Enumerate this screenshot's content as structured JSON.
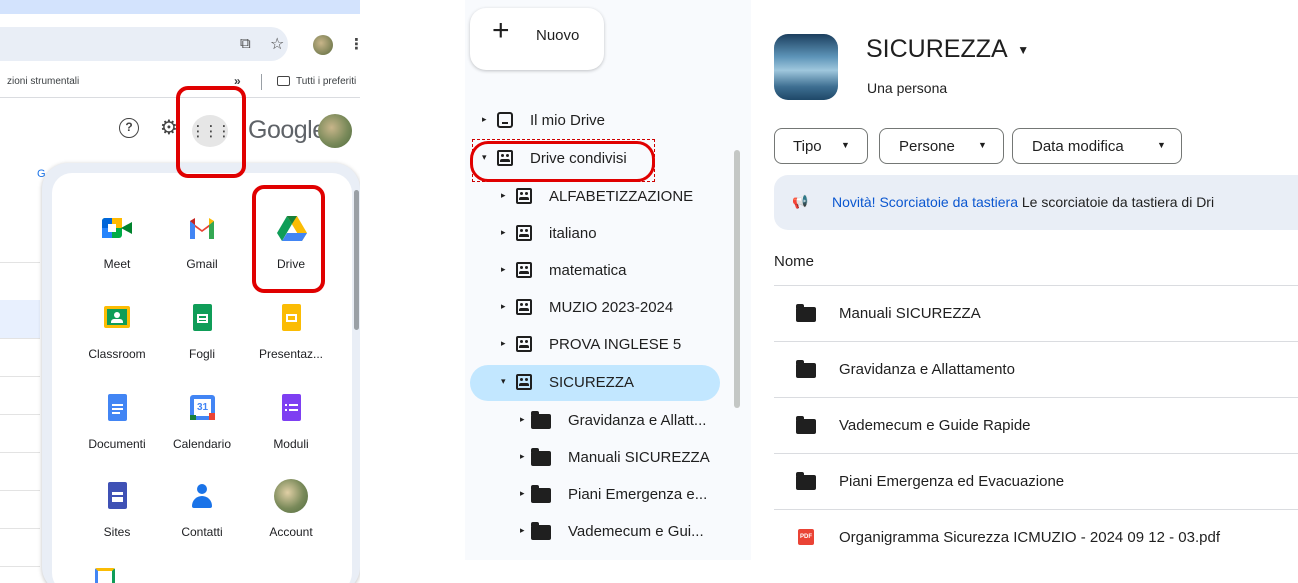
{
  "chrome": {
    "bookmarks_left": "zioni strumentali",
    "bookmarks_chevron": "»",
    "bookmarks_right": "Tutti i preferiti"
  },
  "google_header": {
    "logo_text": "Google"
  },
  "app_launcher": {
    "apps": [
      {
        "label": "Meet",
        "icon": "meet-icon"
      },
      {
        "label": "Gmail",
        "icon": "gmail-icon"
      },
      {
        "label": "Drive",
        "icon": "drive-icon"
      },
      {
        "label": "Classroom",
        "icon": "classroom-icon"
      },
      {
        "label": "Fogli",
        "icon": "sheets-icon"
      },
      {
        "label": "Presentaz...",
        "icon": "slides-icon"
      },
      {
        "label": "Documenti",
        "icon": "docs-icon"
      },
      {
        "label": "Calendario",
        "icon": "calendar-icon"
      },
      {
        "label": "Moduli",
        "icon": "forms-icon"
      },
      {
        "label": "Sites",
        "icon": "sites-icon"
      },
      {
        "label": "Contatti",
        "icon": "contacts-icon"
      },
      {
        "label": "Account",
        "icon": "account-icon"
      }
    ],
    "calendar_day": "31"
  },
  "sidebar": {
    "new_button": "Nuovo",
    "my_drive": "Il mio Drive",
    "shared_drives": "Drive condivisi",
    "items": [
      "ALFABETIZZAZIONE",
      "italiano",
      "matematica",
      "MUZIO 2023-2024",
      "PROVA INGLESE 5",
      "SICUREZZA"
    ],
    "subfolders": [
      "Gravidanza e Allatt...",
      "Manuali SICUREZZA",
      "Piani Emergenza e...",
      "Vademecum e Gui..."
    ]
  },
  "main": {
    "title": "SICUREZZA",
    "members": "Una persona",
    "filters": [
      "Tipo",
      "Persone",
      "Data modifica"
    ],
    "banner_title": "Novità! Scorciatoie da tastiera",
    "banner_text": "Le scorciatoie da tastiera di Dri",
    "column_name": "Nome",
    "files": [
      {
        "name": "Manuali SICUREZZA",
        "type": "folder"
      },
      {
        "name": "Gravidanza e Allattamento",
        "type": "folder"
      },
      {
        "name": "Vademecum e Guide Rapide",
        "type": "folder"
      },
      {
        "name": "Piani Emergenza ed Evacuazione",
        "type": "folder"
      },
      {
        "name": "Organigramma Sicurezza ICMUZIO - 2024 09 12 - 03.pdf",
        "type": "pdf"
      }
    ],
    "pdf_badge": "PDF"
  },
  "colors": {
    "annotation_red": "#e00000",
    "selected_bg": "#c2e7ff",
    "link_blue": "#0b57d0"
  }
}
